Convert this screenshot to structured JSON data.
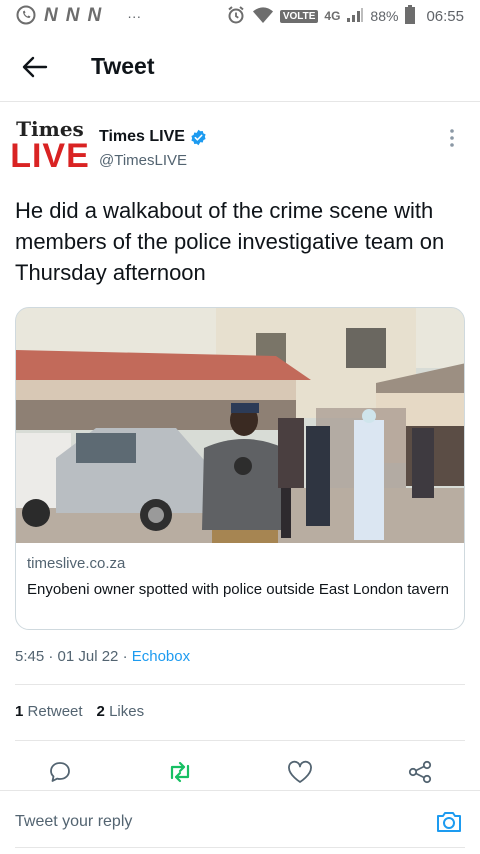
{
  "statusbar": {
    "left_icons": [
      "whatsapp-icon",
      "n-icon",
      "n-icon",
      "n-icon"
    ],
    "n_glyph": "N",
    "dots": "···",
    "volte": "VOLTE",
    "network": "4G",
    "battery_percent": "88%",
    "time": "06:55"
  },
  "header": {
    "title": "Tweet"
  },
  "tweet": {
    "author_name": "Times LIVE",
    "author_handle": "@TimesLIVE",
    "logo_top": "Times",
    "logo_bottom": "LIVE",
    "text": "He did a walkabout of the crime scene with members of the police investigative team on Thursday afternoon",
    "card": {
      "domain": "timeslive.co.za",
      "title": "Enyobeni owner spotted with police outside East London tavern"
    },
    "timestamp": "5:45 · 01 Jul 22 · ",
    "source": "Echobox",
    "retweets_count": "1",
    "retweets_label": "Retweet",
    "likes_count": "2",
    "likes_label": "Likes"
  },
  "reply": {
    "placeholder": "Tweet your reply"
  },
  "colors": {
    "accent": "#1d9bf0",
    "retweet_green": "#17bf63",
    "logo_red": "#d92323"
  }
}
